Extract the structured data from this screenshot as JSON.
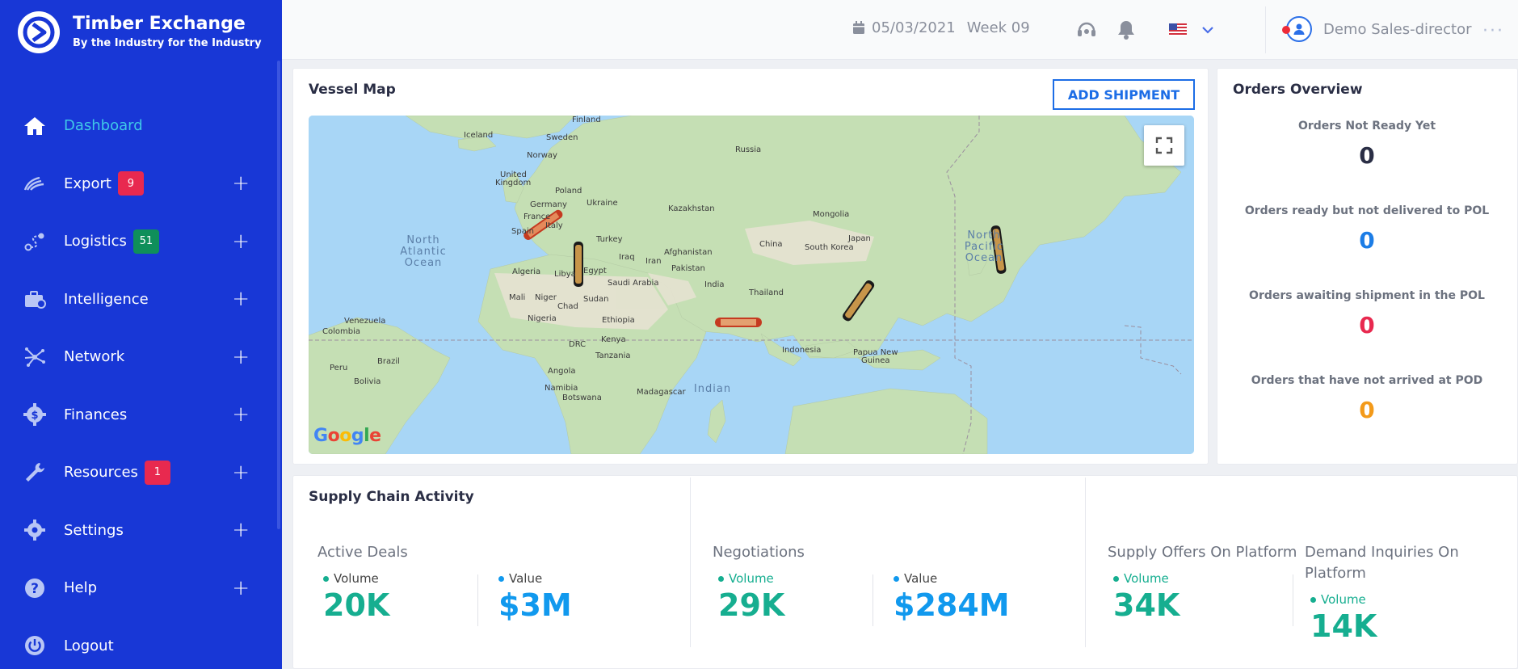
{
  "brand": {
    "title": "Timber Exchange",
    "subtitle": "By the Industry for the Industry"
  },
  "sidebar": {
    "items": [
      {
        "label": "Dashboard",
        "icon": "home-icon",
        "badge": "",
        "active": true
      },
      {
        "label": "Export",
        "icon": "export-icon",
        "badge": "9"
      },
      {
        "label": "Logistics",
        "icon": "route-icon",
        "badge": "51"
      },
      {
        "label": "Intelligence",
        "icon": "briefcase-icon",
        "badge": ""
      },
      {
        "label": "Network",
        "icon": "network-icon",
        "badge": ""
      },
      {
        "label": "Finances",
        "icon": "cog-dollar-icon",
        "badge": ""
      },
      {
        "label": "Resources",
        "icon": "wrench-icon",
        "badge": "1"
      },
      {
        "label": "Settings",
        "icon": "gear-icon",
        "badge": ""
      },
      {
        "label": "Help",
        "icon": "help-icon",
        "badge": ""
      },
      {
        "label": "Logout",
        "icon": "power-icon",
        "badge": ""
      }
    ]
  },
  "topbar": {
    "date": "05/03/2021",
    "week": "Week 09",
    "user": "Demo Sales-director"
  },
  "vessel_map": {
    "title": "Vessel Map",
    "add_button": "ADD SHIPMENT",
    "google": "Google",
    "labels": {
      "finland": "Finland",
      "iceland": "Iceland",
      "sweden": "Sweden",
      "russia": "Russia",
      "norway": "Norway",
      "uk1": "United",
      "uk2": "Kingdom",
      "poland": "Poland",
      "germany": "Germany",
      "ukraine": "Ukraine",
      "kazakhstan": "Kazakhstan",
      "mongolia": "Mongolia",
      "france": "France",
      "spain": "Spain",
      "italy": "Italy",
      "turkey": "Turkey",
      "china": "China",
      "south_korea": "South Korea",
      "japan": "Japan",
      "na1": "North",
      "na2": "Atlantic",
      "na3": "Ocean",
      "np1": "North",
      "np2": "Pacific",
      "np3": "Ocean",
      "afghanistan": "Afghanistan",
      "iraq": "Iraq",
      "iran": "Iran",
      "pakistan": "Pakistan",
      "algeria": "Algeria",
      "libya": "Libya",
      "egypt": "Egypt",
      "saudi": "Saudi Arabia",
      "india": "India",
      "thailand": "Thailand",
      "mali": "Mali",
      "niger": "Niger",
      "chad": "Chad",
      "sudan": "Sudan",
      "nigeria": "Nigeria",
      "ethiopia": "Ethiopia",
      "venezuela": "Venezuela",
      "colombia": "Colombia",
      "drc": "DRC",
      "kenya": "Kenya",
      "tanzania": "Tanzania",
      "indonesia": "Indonesia",
      "png1": "Papua New",
      "png2": "Guinea",
      "brazil": "Brazil",
      "peru": "Peru",
      "bolivia": "Bolivia",
      "angola": "Angola",
      "namibia": "Namibia",
      "botswana": "Botswana",
      "madagascar": "Madagascar",
      "indian": "Indian"
    }
  },
  "orders_overview": {
    "title": "Orders Overview",
    "items": [
      {
        "label": "Orders Not Ready Yet",
        "value": "0",
        "color": "#2a2e45"
      },
      {
        "label": "Orders ready but not delivered to POL",
        "value": "0",
        "color": "#1c7de6"
      },
      {
        "label": "Orders awaiting shipment in the POL",
        "value": "0",
        "color": "#e8294f"
      },
      {
        "label": "Orders that have not arrived at POD",
        "value": "0",
        "color": "#f39a1a"
      }
    ]
  },
  "supply_chain": {
    "title": "Supply Chain Activity",
    "active_deals": {
      "label": "Active Deals",
      "volume_label": "Volume",
      "volume": "20K",
      "value_label": "Value",
      "value": "$3M"
    },
    "negotiations": {
      "label": "Negotiations",
      "volume_label": "Volume",
      "volume": "29K",
      "value_label": "Value",
      "value": "$284M"
    },
    "supply_offers": {
      "label": "Supply Offers On Platform",
      "volume_label": "Volume",
      "volume": "34K"
    },
    "demand_inquiries": {
      "label": "Demand Inquiries On Platform",
      "volume_label": "Volume",
      "volume": "14K"
    }
  },
  "colors": {
    "sidebar": "#1837d6",
    "teal": "#16ae90",
    "blue": "#1199ee",
    "accent": "#1c6de6"
  }
}
